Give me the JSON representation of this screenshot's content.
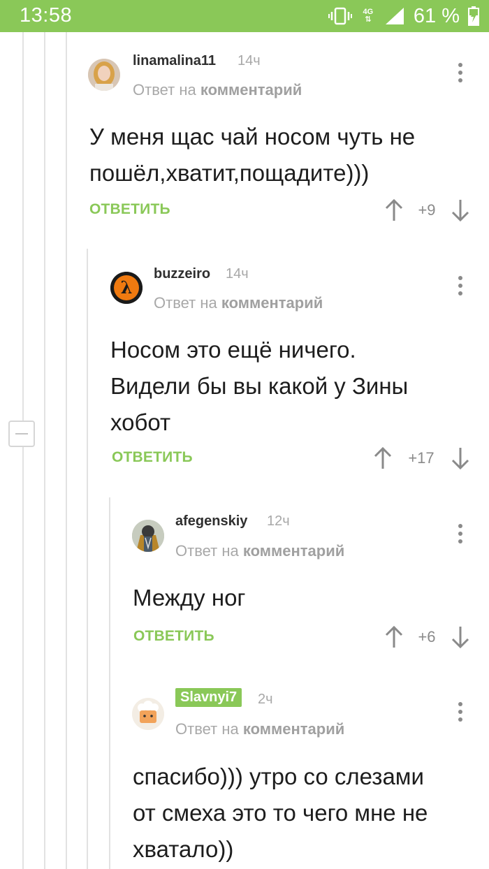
{
  "status_bar": {
    "time": "13:58",
    "network": "4G",
    "battery_percent": "61 %"
  },
  "comments": [
    {
      "author": "linamalina11",
      "time": "14ч",
      "reply_prefix": "Ответ на",
      "reply_link": "комментарий",
      "text_lines": [
        "У меня щас чай носом чуть не",
        "пошёл,хватит,пощадите)))"
      ],
      "reply_label": "ОТВЕТИТЬ",
      "score": "+9"
    },
    {
      "author": "buzzeiro",
      "time": "14ч",
      "reply_prefix": "Ответ на",
      "reply_link": "комментарий",
      "text_lines": [
        "Носом это ещё ничего.",
        "Видели бы вы какой у Зины",
        "хобот"
      ],
      "reply_label": "ОТВЕТИТЬ",
      "score": "+17"
    },
    {
      "author": "afegenskiy",
      "time": "12ч",
      "reply_prefix": "Ответ на",
      "reply_link": "комментарий",
      "text_lines": [
        "Между ног"
      ],
      "reply_label": "ОТВЕТИТЬ",
      "score": "+6"
    },
    {
      "author": "Slavnyi7",
      "time": "2ч",
      "reply_prefix": "Ответ на",
      "reply_link": "комментарий",
      "text_lines": [
        "спасибо))) утро со слезами",
        "от смеха это то чего мне не",
        "хватало))"
      ]
    }
  ],
  "colors": {
    "accent": "#8ac858",
    "muted": "#a8a8a8"
  }
}
